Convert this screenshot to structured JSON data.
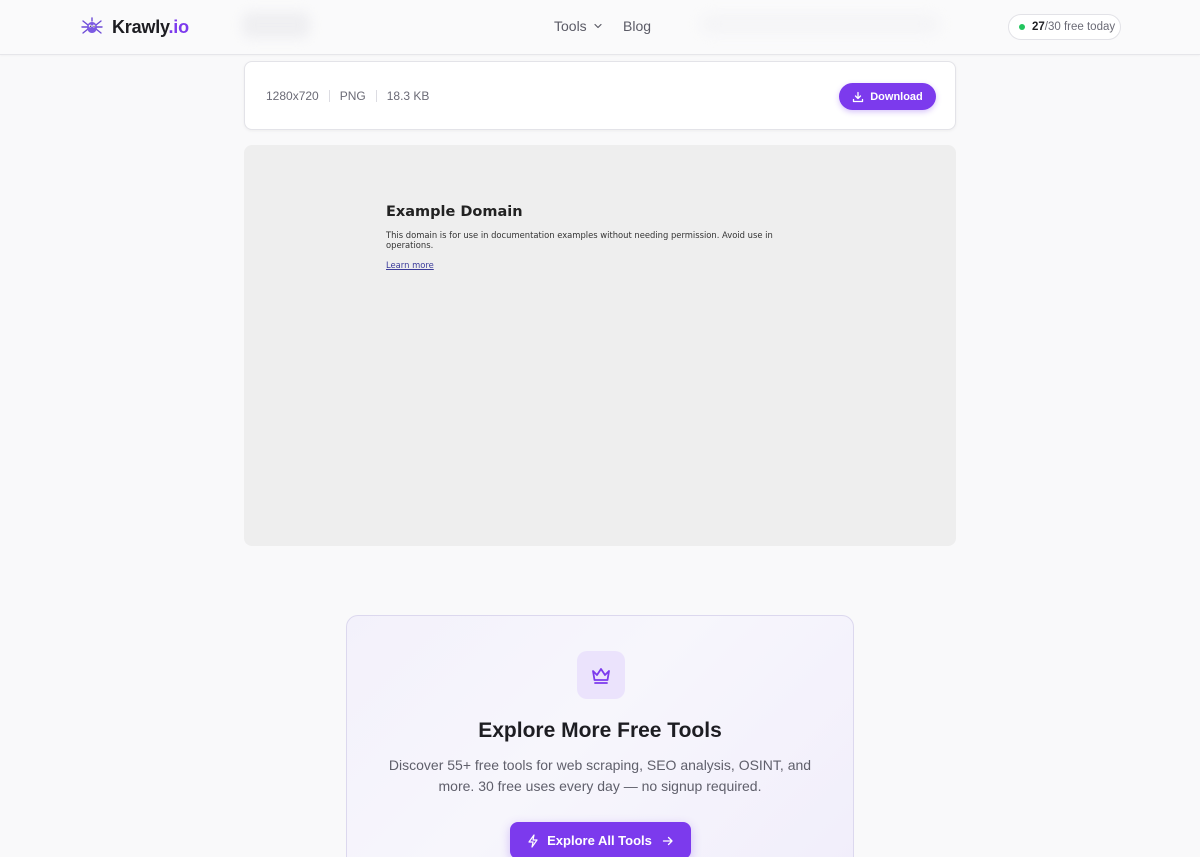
{
  "header": {
    "brand_main": "Krawly",
    "brand_tld": ".io",
    "nav": [
      {
        "label": "Tools",
        "icon": "chevron-down-icon"
      },
      {
        "label": "Blog"
      }
    ],
    "quota": {
      "used": "27",
      "rest": "/30 free today",
      "status_color": "#22c55e"
    }
  },
  "result": {
    "resolution": "1280x720",
    "format": "PNG",
    "size": "18.3 KB",
    "download_label": "Download"
  },
  "preview": {
    "title": "Example Domain",
    "body": "This domain is for use in documentation examples without needing permission. Avoid use in operations.",
    "link": "Learn more"
  },
  "explore": {
    "icon": "crown-icon",
    "title": "Explore More Free Tools",
    "description": "Discover 55+ free tools for web scraping, SEO analysis, OSINT, and more. 30 free uses every day — no signup required.",
    "button_label": "Explore All Tools"
  },
  "colors": {
    "accent": "#7c3aed",
    "background": "#f9f9fa"
  }
}
